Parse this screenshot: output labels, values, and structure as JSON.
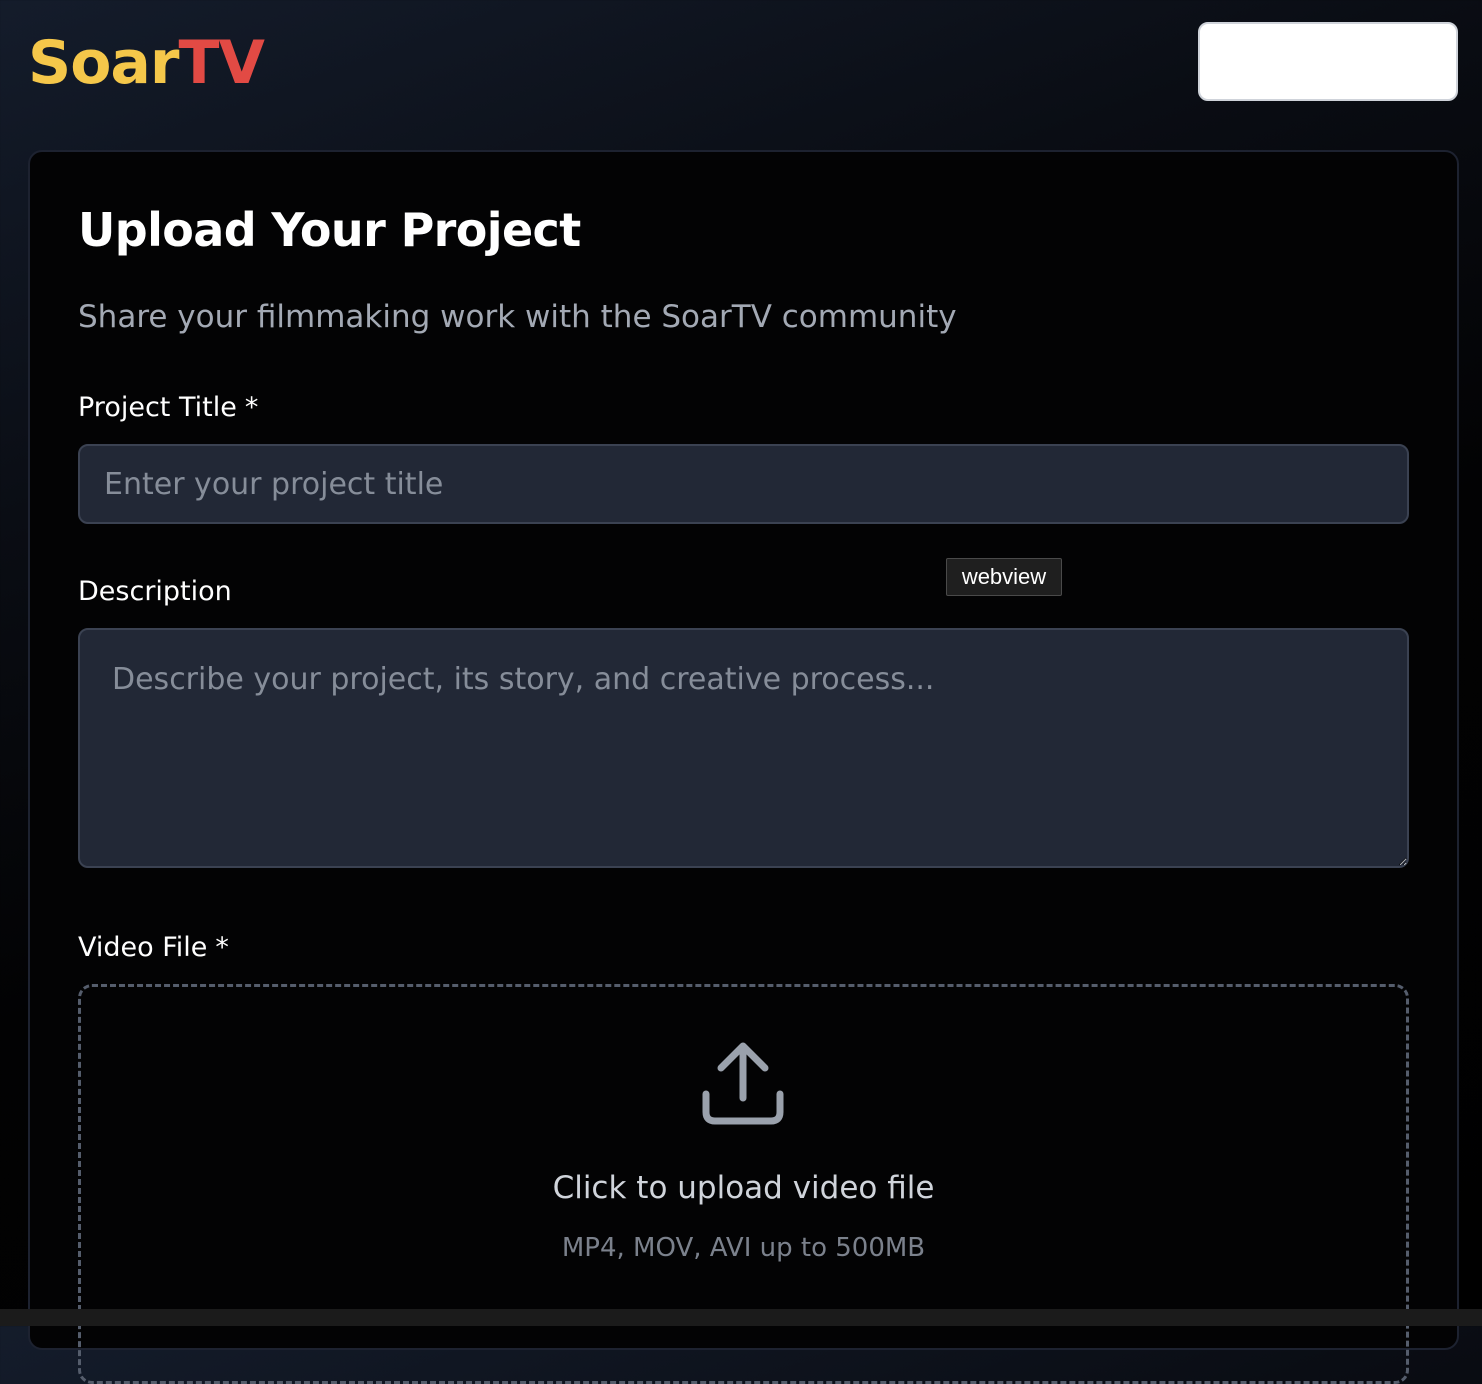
{
  "brand": {
    "part1": "Soar",
    "part2": "TV",
    "color1": "#f5c74a",
    "color2": "#e24a44"
  },
  "header": {
    "button_label": ""
  },
  "form": {
    "title": "Upload Your Project",
    "subtitle": "Share your filmmaking work with the SoarTV community",
    "project_title": {
      "label": "Project Title",
      "required_mark": "*",
      "value": "",
      "placeholder": "Enter your project title"
    },
    "description": {
      "label": "Description",
      "value": "",
      "placeholder": "Describe your project, its story, and creative process..."
    },
    "video_file": {
      "label": "Video File",
      "required_mark": "*",
      "icon": "upload-icon",
      "prompt": "Click to upload video file",
      "hint": "MP4, MOV, AVI up to 500MB"
    }
  },
  "tooltip": {
    "text": "webview"
  }
}
